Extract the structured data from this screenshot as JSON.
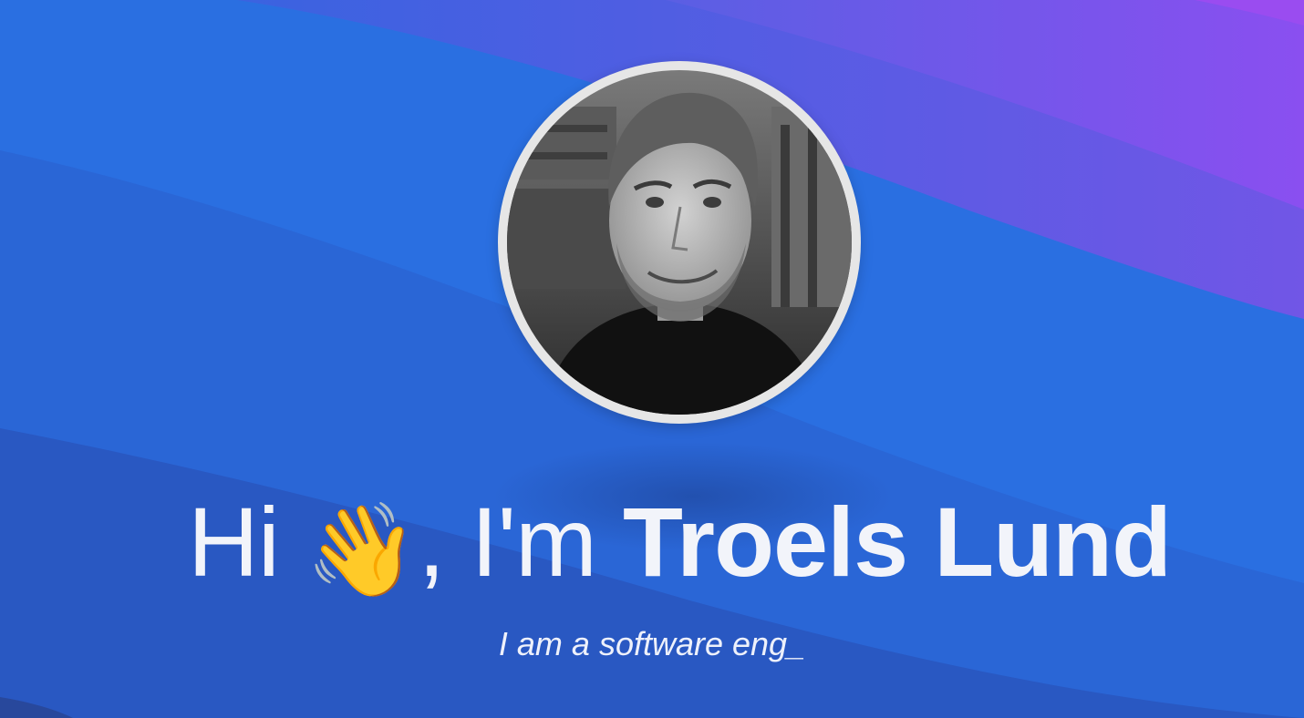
{
  "colors": {
    "band_1": "#2a6fe1",
    "band_2": "#2a66d6",
    "band_3": "#2958c2",
    "band_4": "#2a4fae",
    "purple_1": "#5b63e2",
    "purple_2": "#7258e6",
    "text": "#f2f4fa",
    "avatar_ring": "#e6e6e6"
  },
  "hero": {
    "avatar_alt": "Photo of Troels Lund",
    "greeting": "Hi",
    "wave_emoji": "👋",
    "intro": ", I'm",
    "name": "Troels Lund",
    "tagline": "I am a software eng_"
  }
}
